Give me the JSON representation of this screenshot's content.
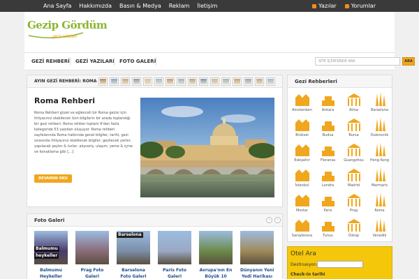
{
  "topnav": {
    "items": [
      "Ana Sayfa",
      "Hakkımızda",
      "Basın & Medya",
      "Reklam",
      "İletişim"
    ],
    "rss": [
      "Yazılar",
      "Yorumlar"
    ]
  },
  "logo": {
    "main": "Gezip Gördüm",
    "sub": "gezi rehberi"
  },
  "nav": {
    "items": [
      "GEZİ REHBERİ",
      "GEZİ YAZILARI",
      "FOTO GALERİ"
    ],
    "search_placeholder": "SİTE İÇERİSİNDE ARA",
    "search_button": "ARA"
  },
  "featured": {
    "header": "AYIN GEZİ REHBERİ: ROMA",
    "title": "Roma Rehberi",
    "text": "Roma Rehberi güzel ve eğlenceli bir Roma gezisi için ihtiyacınız olabilecek tüm bilgilerin bir arada toplandığı bir gezi rehberi. Roma rehber toplam 9'dan fazla kategoride 53 yazıdan oluşuyor. Roma rehberi sayfalarında Roma hakkında genel bilgiler, tarihi, gezi sırasında ihtiyacınız olabilecek bilgiler, gezilecek yerler, yapılacak şeyler & turlar, alışveriş, ulaşım, yeme & içme ve konaklama gibi [...]",
    "button": "DEVAMINI OKU",
    "thumb_colors": [
      "#b58a5a",
      "#7fa3c7",
      "#c9a97a",
      "#8a9bb0",
      "#d7c2a0",
      "#a7b8c9",
      "#c49a6c",
      "#9bb3c2",
      "#b9a48a",
      "#7d94ad",
      "#d0b58f",
      "#a2b2bd",
      "#c7a27c",
      "#8ea7bd",
      "#bfa98a",
      "#9fb6c8"
    ]
  },
  "galeri": {
    "title": "Foto Galeri",
    "prev": "‹",
    "next": "›",
    "items": [
      {
        "caption1": "Balmumu",
        "caption2": "Heykeller",
        "overlay1": "Balmumu",
        "overlay2": "heykeller",
        "color": "#4a3b6b"
      },
      {
        "caption1": "Prag Foto",
        "caption2": "Galeri",
        "overlay1": "",
        "overlay2": "",
        "color": "#8b6b7a"
      },
      {
        "caption1": "Barselona",
        "caption2": "Foto Galeri",
        "overlay1": "Barselona",
        "overlay2": "",
        "color": "#7b8fa8"
      },
      {
        "caption1": "Paris Foto",
        "caption2": "Galeri",
        "overlay1": "",
        "overlay2": "",
        "color": "#9aa9c4"
      },
      {
        "caption1": "Avrupa'nın En",
        "caption2": "Büyük 10",
        "overlay1": "",
        "overlay2": "",
        "color": "#6b8a4a"
      },
      {
        "caption1": "Dünyanın Yeni",
        "caption2": "Yedi Harikası",
        "overlay1": "",
        "overlay2": "",
        "color": "#a08a5a"
      }
    ]
  },
  "rehber": {
    "title": "Gezi Rehberleri",
    "icon_color": "#f0a71d",
    "cities": [
      "Amsterdam",
      "Ankara",
      "Atina",
      "Barselona",
      "Brüksel",
      "Budva",
      "Bursa",
      "Dubrovnik",
      "Eskişehir",
      "Floransa",
      "Guangzhou",
      "Hong Kong",
      "İstanbul",
      "Londra",
      "Madrid",
      "Marmaris",
      "Mostar",
      "Paris",
      "Prag",
      "Roma",
      "Saraybosna",
      "Tunus",
      "Üsküp",
      "Venedik"
    ],
    "icons": [
      "building-icon",
      "mausoleum-icon",
      "temple-icon",
      "sagrada-familia-icon",
      "atomium-icon",
      "coast-icon",
      "mosque-icon",
      "fortress-icon",
      "tower-icon",
      "dome-icon",
      "canton-tower-icon",
      "skyline-icon",
      "hagia-sophia-icon",
      "tower-bridge-icon",
      "arch-icon",
      "boat-icon",
      "bridge-icon",
      "eiffel-tower-icon",
      "castle-icon",
      "colosseum-icon",
      "bridge-icon",
      "minaret-icon",
      "clock-tower-icon",
      "gondola-icon"
    ]
  },
  "otel": {
    "title": "Otel Ara",
    "destination_label": "Destinasyon",
    "checkin_label": "Check-in tarihi"
  }
}
